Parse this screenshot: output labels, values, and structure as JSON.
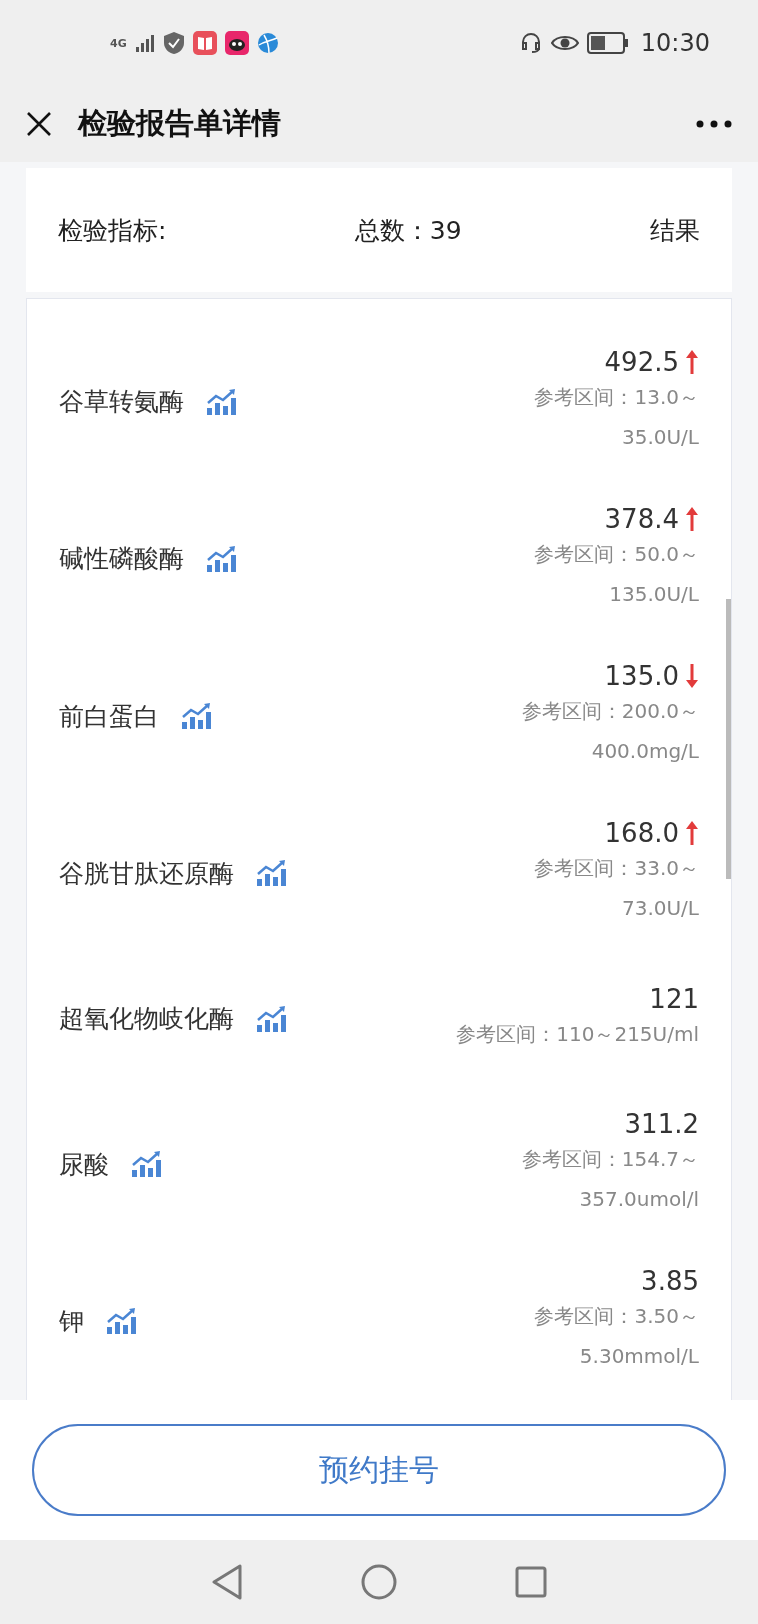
{
  "status_bar": {
    "network": "4G",
    "time": "10:30"
  },
  "header": {
    "title": "检验报告单详情"
  },
  "summary": {
    "label": "检验指标:",
    "total": "总数：39",
    "result": "结果"
  },
  "items": [
    {
      "name": "谷草转氨酶",
      "value": "492.5",
      "high": true,
      "low": false,
      "reference": [
        "参考区间：13.0～",
        "35.0U/L"
      ]
    },
    {
      "name": "碱性磷酸酶",
      "value": "378.4",
      "high": true,
      "low": false,
      "reference": [
        "参考区间：50.0～",
        "135.0U/L"
      ]
    },
    {
      "name": "前白蛋白",
      "value": "135.0",
      "high": false,
      "low": true,
      "reference": [
        "参考区间：200.0～",
        "400.0mg/L"
      ]
    },
    {
      "name": "谷胱甘肽还原酶",
      "value": "168.0",
      "high": true,
      "low": false,
      "reference": [
        "参考区间：33.0～",
        "73.0U/L"
      ]
    },
    {
      "name": "超氧化物岐化酶",
      "value": "121",
      "high": false,
      "low": false,
      "reference": [
        "参考区间：110～215U/ml"
      ]
    },
    {
      "name": "尿酸",
      "value": "311.2",
      "high": false,
      "low": false,
      "reference": [
        "参考区间：154.7～",
        "357.0umol/l"
      ]
    },
    {
      "name": "钾",
      "value": "3.85",
      "high": false,
      "low": false,
      "reference": [
        "参考区间：3.50～",
        "5.30mmol/L"
      ]
    }
  ],
  "button": {
    "label": "预约挂号"
  }
}
